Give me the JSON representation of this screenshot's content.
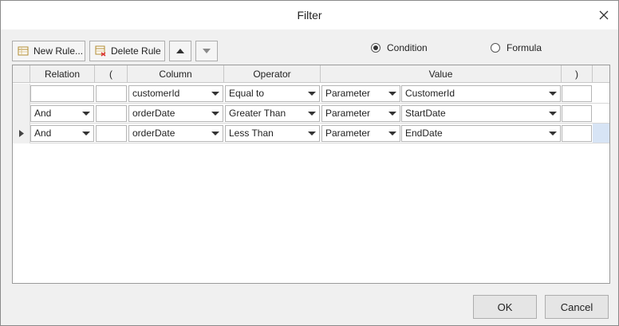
{
  "dialog": {
    "title": "Filter"
  },
  "toolbar": {
    "new_rule": "New Rule...",
    "delete_rule": "Delete Rule"
  },
  "mode": {
    "condition_label": "Condition",
    "formula_label": "Formula",
    "selected": "Condition"
  },
  "grid": {
    "headers": {
      "relation": "Relation",
      "open_paren": "(",
      "column": "Column",
      "operator": "Operator",
      "value": "Value",
      "close_paren": ")"
    },
    "rows": [
      {
        "relation": "",
        "open_paren": "",
        "column": "customerId",
        "operator": "Equal to",
        "value_type": "Parameter",
        "value": "CustomerId",
        "close_paren": ""
      },
      {
        "relation": "And",
        "open_paren": "",
        "column": "orderDate",
        "operator": "Greater Than",
        "value_type": "Parameter",
        "value": "StartDate",
        "close_paren": ""
      },
      {
        "relation": "And",
        "open_paren": "",
        "column": "orderDate",
        "operator": "Less Than",
        "value_type": "Parameter",
        "value": "EndDate",
        "close_paren": ""
      }
    ],
    "current_row": 3
  },
  "footer": {
    "ok": "OK",
    "cancel": "Cancel"
  }
}
